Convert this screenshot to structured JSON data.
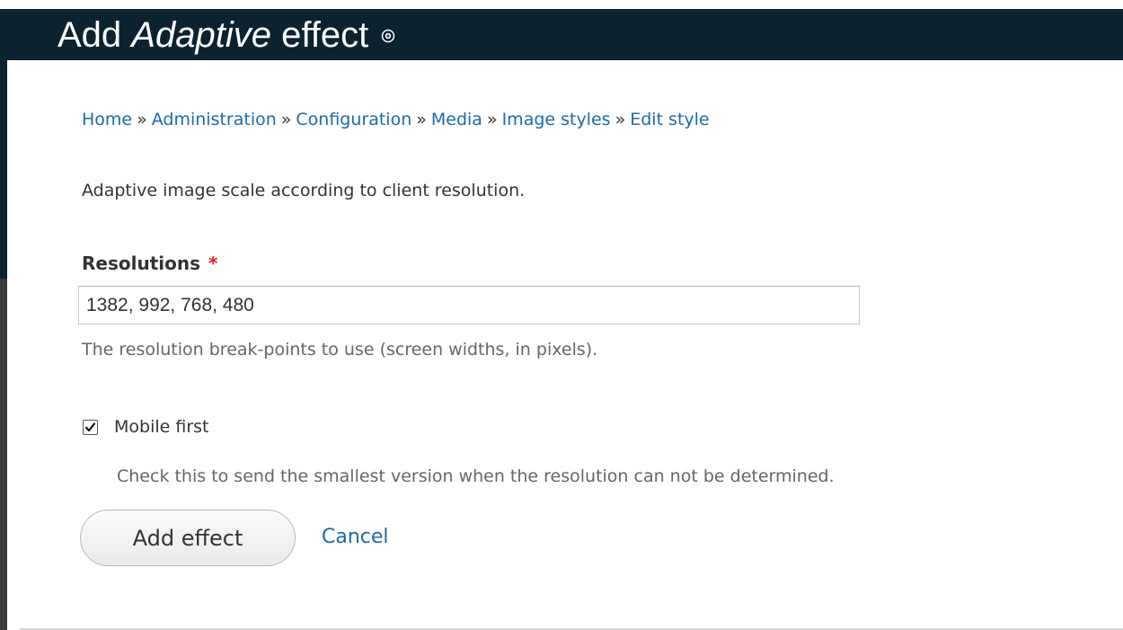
{
  "header": {
    "title_prefix": "Add",
    "title_emphasis": "Adaptive",
    "title_suffix": "effect"
  },
  "breadcrumb": {
    "separator": "»",
    "items": [
      {
        "label": "Home"
      },
      {
        "label": "Administration"
      },
      {
        "label": "Configuration"
      },
      {
        "label": "Media"
      },
      {
        "label": "Image styles"
      },
      {
        "label": "Edit style"
      }
    ]
  },
  "description": "Adaptive image scale according to client resolution.",
  "resolutions_field": {
    "label": "Resolutions",
    "required_mark": "*",
    "value": "1382, 992, 768, 480",
    "help": "The resolution break-points to use (screen widths, in pixels)."
  },
  "mobile_first": {
    "label": "Mobile first",
    "checked": true,
    "help": "Check this to send the smallest version when the resolution can not be determined."
  },
  "actions": {
    "submit_label": "Add effect",
    "cancel_label": "Cancel"
  },
  "colors": {
    "header_bg": "#0b2230",
    "link": "#1f6aa8",
    "required": "#e0231c"
  },
  "icons": {
    "title_shortcut": "add-shortcut-icon",
    "checkbox_check": "checkmark-icon"
  }
}
